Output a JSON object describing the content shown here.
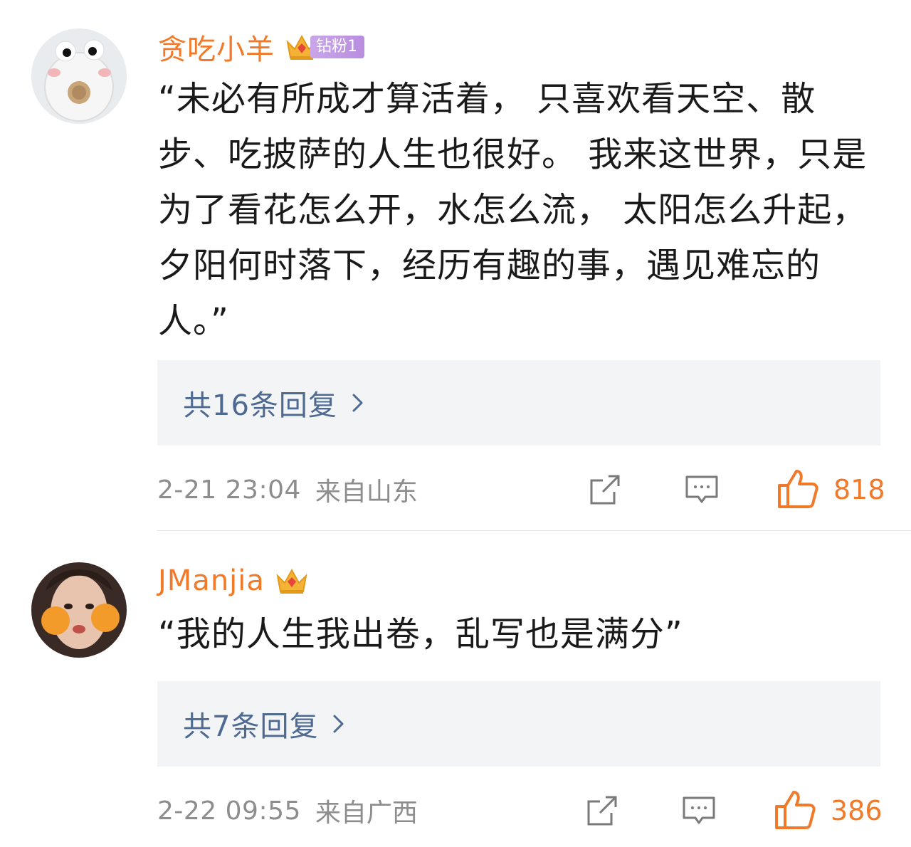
{
  "comments": [
    {
      "username": "贪吃小羊",
      "badge_label": "钻粉1",
      "text": "“未必有所成才算活着， 只喜欢看天空、散步、吃披萨的人生也很好。 我来这世界，只是为了看花怎么开，水怎么流， 太阳怎么升起，夕阳何时落下，经历有趣的事，遇见难忘的人。”",
      "replies_label": "共16条回复",
      "time": "2-21 23:04",
      "location": "来自山东",
      "like_count": "818",
      "avatar_icon": "donut-avatar",
      "accent_color": "#f07a2a"
    },
    {
      "username": "JManjia",
      "text": "“我的人生我出卷，乱写也是满分”",
      "replies_label": "共7条回复",
      "time": "2-22 09:55",
      "location": "来自广西",
      "like_count": "386",
      "avatar_icon": "photo-avatar"
    }
  ],
  "colors": {
    "username": "#f07a2a",
    "link": "#4e6a92",
    "meta": "#8d8d8d",
    "reply_bg": "#f3f4f6"
  }
}
